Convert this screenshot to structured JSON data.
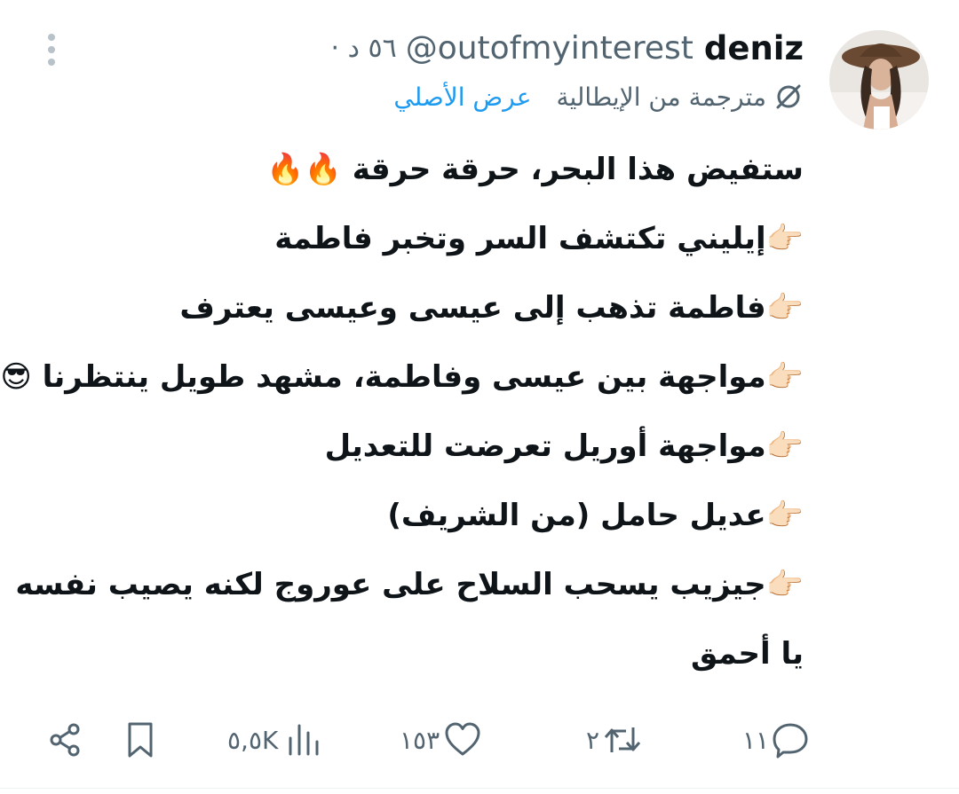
{
  "tweet": {
    "author_name": "deniz",
    "handle": "@outofmyinterest",
    "time": "· ٥٦ د",
    "translated_label": "مترجمة من الإيطالية",
    "show_original": "عرض الأصلي",
    "lines": [
      "ستفيض هذا البحر، حرقة حرقة 🔥🔥",
      "👉🏻إيليني تكتشف السر وتخبر فاطمة",
      "👉🏻فاطمة تذهب إلى عيسى وعيسى يعترف",
      "👉🏻مواجهة بين عيسى وفاطمة، مشهد طويل ينتظرنا 😎",
      "👉🏻مواجهة أوريل تعرضت للتعديل",
      "👉🏻عديل حامل (من الشريف)",
      "👉🏻جيزيب يسحب السلاح على عوروج لكنه يصيب نفسه",
      "يا أحمق"
    ]
  },
  "actions": {
    "replies": "١١",
    "retweets": "٢",
    "likes": "١٥٣",
    "views": "٥,٥K"
  },
  "icons": {
    "more": "more-vertical-icon",
    "translate": "translate-icon",
    "reply": "reply-icon",
    "retweet": "retweet-icon",
    "like": "heart-icon",
    "views": "views-icon",
    "bookmark": "bookmark-icon",
    "share": "share-icon"
  },
  "colors": {
    "accent": "#1d9bf0",
    "secondary_text": "#536471",
    "primary_text": "#0f1419",
    "icon_gray": "#b8c2c9"
  }
}
